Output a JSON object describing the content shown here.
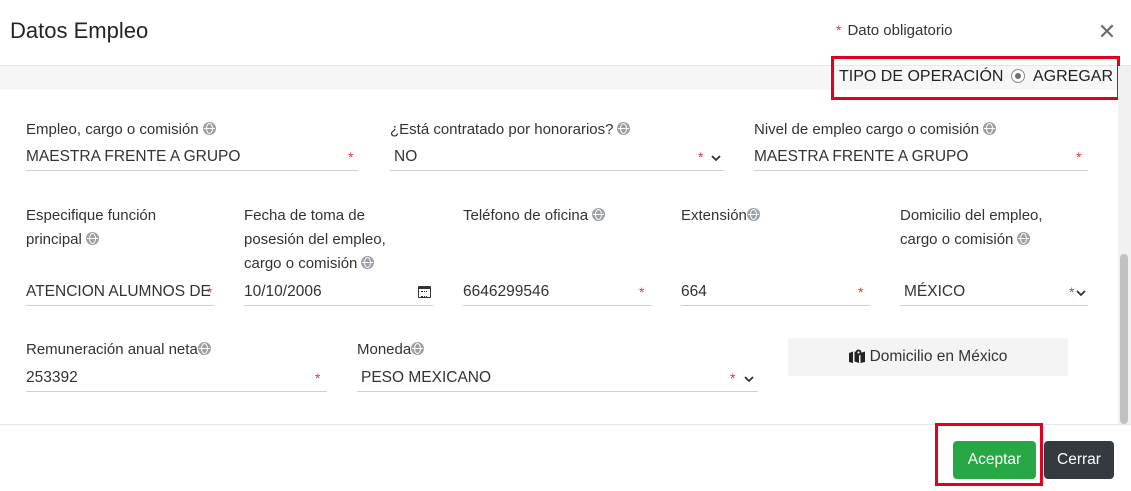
{
  "header": {
    "title": "Datos Empleo",
    "required_star": "*",
    "required_note": "Dato obligatorio",
    "close_glyph": "✕"
  },
  "operation": {
    "label": "TIPO DE OPERACIÓN",
    "value": "AGREGAR"
  },
  "fields": {
    "empleo": {
      "label": "Empleo, cargo o comisión",
      "value": "MAESTRA FRENTE A GRUPO"
    },
    "honorarios": {
      "label": "¿Está contratado por honorarios?",
      "value": "NO"
    },
    "nivel": {
      "label": "Nivel de empleo cargo o comisión",
      "value": "MAESTRA FRENTE A GRUPO"
    },
    "funcion": {
      "label_line1": "Especifique función",
      "label_line2": "principal",
      "value": "ATENCION ALUMNOS DE"
    },
    "fecha": {
      "label_line1": "Fecha de toma de",
      "label_line2": "posesión del empleo,",
      "label_line3": "cargo o comisión",
      "value": "10/10/2006"
    },
    "telefono": {
      "label": "Teléfono de oficina",
      "value": "6646299546"
    },
    "extension": {
      "label": "Extensión",
      "value": "664"
    },
    "domicilio": {
      "label_line1": "Domicilio del empleo,",
      "label_line2": "cargo o comisión",
      "value": "MÉXICO"
    },
    "remuneracion": {
      "label": "Remuneración anual neta",
      "value": "253392"
    },
    "moneda": {
      "label": "Moneda",
      "value": "PESO MEXICANO"
    }
  },
  "buttons": {
    "domicilio_mexico": "Domicilio en México",
    "accept": "Aceptar",
    "close": "Cerrar"
  },
  "colors": {
    "accent_green": "#28a745",
    "dark_button": "#343a40",
    "required_red": "#e8343b",
    "highlight_red": "#e0001f"
  }
}
